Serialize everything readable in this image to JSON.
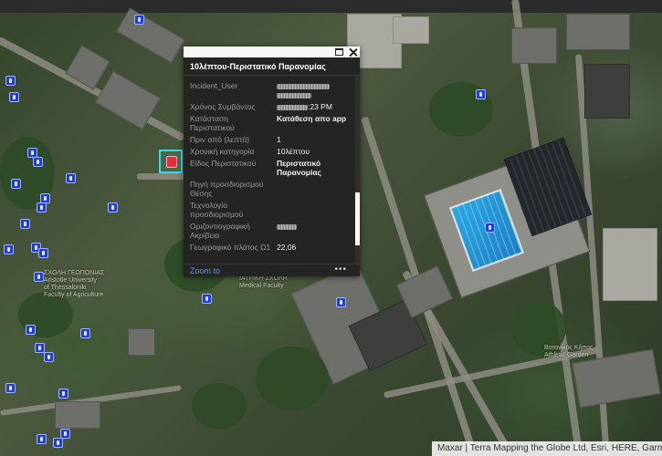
{
  "map": {
    "labels": {
      "university": "ΣΧΟΛΗ ΓΕΩΠΟΝΙΑΣ\nAristotle University\nof Thessaloniki\nFaculty of Agriculture",
      "faculty": "ΙΑΤΡΙΚΗ ΣΧΟΛΗ\nMedical Faculty",
      "garden": "Βοτανικός Κήπος\nAthletic Garden"
    },
    "attribution": "Maxar | Terra Mapping the Globe Ltd, Esri, HERE, Garmin, O"
  },
  "popup": {
    "title": "10λέπτου-Περιστατικό Παρανομίας",
    "zoom_to": "Zoom to",
    "more": "•••",
    "fields": [
      {
        "key": "Incident_User",
        "value": "",
        "redacted": true
      },
      {
        "key": "Χρόνος Συμβάντος",
        "value": ":23 PM",
        "redacted": true
      },
      {
        "key": "Κατάσταση Περιστατικού",
        "value": "Κατάθεση απο app"
      },
      {
        "key": "Πριν από (λεπτά)",
        "value": "1"
      },
      {
        "key": "Χρονική κατηγορία",
        "value": "10λέπτου"
      },
      {
        "key": "Είδος Περιστατικού",
        "value": "Περιστατικό Παρανομίας"
      },
      {
        "key": "Πηγή προσδιορισμού Θέσης",
        "value": ""
      },
      {
        "key": "Τεχνολογία προσδιορισμού",
        "value": ""
      },
      {
        "key": "Οριζοντιογραφική Ακρίβεια",
        "value": "",
        "redacted": true
      },
      {
        "key": "Γεωγραφικό πλάτος Ω1",
        "value": "22,06"
      }
    ]
  },
  "icons": {
    "dock": "dock-icon",
    "close": "close-icon",
    "incident": "incident-marker-icon"
  },
  "colors": {
    "marker": "#1f3fd6",
    "selected_marker": "#e0303a",
    "selection_halo": "#3fd9e6",
    "link": "#5b9bd5"
  }
}
